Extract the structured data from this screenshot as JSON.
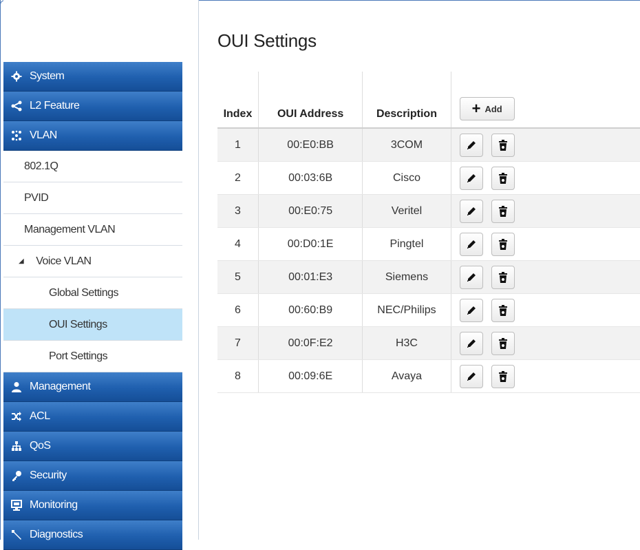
{
  "sidebar": {
    "items": [
      {
        "label": "System",
        "icon": "gear-icon"
      },
      {
        "label": "L2 Feature",
        "icon": "share-icon"
      },
      {
        "label": "VLAN",
        "icon": "network-icon"
      },
      {
        "label": "802.1Q"
      },
      {
        "label": "PVID"
      },
      {
        "label": "Management VLAN"
      },
      {
        "label": "Voice VLAN",
        "expanded": true
      },
      {
        "label": "Global Settings"
      },
      {
        "label": "OUI Settings",
        "active": true
      },
      {
        "label": "Port Settings"
      },
      {
        "label": "Management",
        "icon": "user-icon"
      },
      {
        "label": "ACL",
        "icon": "shuffle-icon"
      },
      {
        "label": "QoS",
        "icon": "sitemap-icon"
      },
      {
        "label": "Security",
        "icon": "key-icon"
      },
      {
        "label": "Monitoring",
        "icon": "monitor-icon"
      },
      {
        "label": "Diagnostics",
        "icon": "wrench-icon"
      }
    ]
  },
  "main": {
    "title": "OUI Settings",
    "columns": [
      "Index",
      "OUI Address",
      "Description"
    ],
    "add_label": "Add",
    "rows": [
      {
        "index": "1",
        "oui": "00:E0:BB",
        "desc": "3COM"
      },
      {
        "index": "2",
        "oui": "00:03:6B",
        "desc": "Cisco"
      },
      {
        "index": "3",
        "oui": "00:E0:75",
        "desc": "Veritel"
      },
      {
        "index": "4",
        "oui": "00:D0:1E",
        "desc": "Pingtel"
      },
      {
        "index": "5",
        "oui": "00:01:E3",
        "desc": "Siemens"
      },
      {
        "index": "6",
        "oui": "00:60:B9",
        "desc": "NEC/Philips"
      },
      {
        "index": "7",
        "oui": "00:0F:E2",
        "desc": "H3C"
      },
      {
        "index": "8",
        "oui": "00:09:6E",
        "desc": "Avaya"
      }
    ]
  },
  "colors": {
    "nav_gradient_top": "#3f7fc9",
    "nav_gradient_bottom": "#154e97",
    "active_item": "#bfe3f8",
    "row_alt": "#f2f2f2"
  }
}
